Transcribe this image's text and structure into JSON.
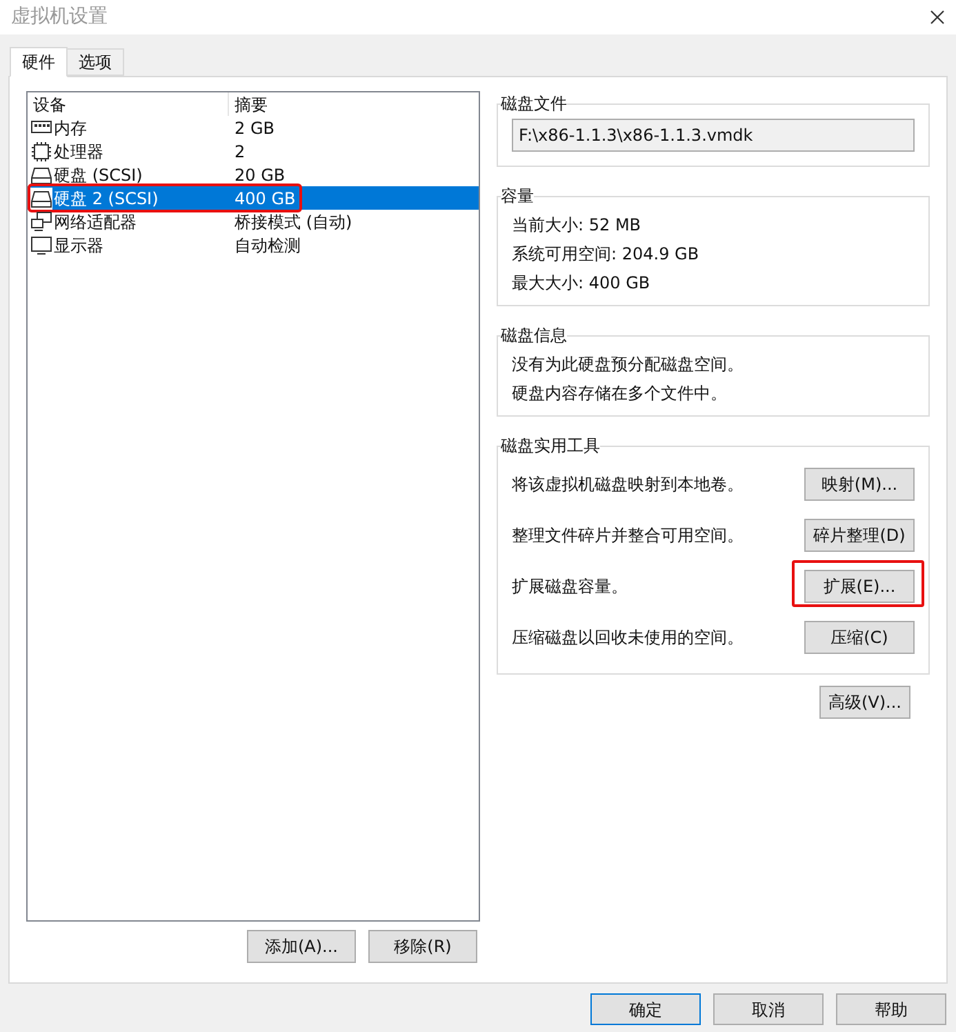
{
  "window": {
    "title": "虚拟机设置"
  },
  "tabs": [
    {
      "label": "硬件",
      "selected": true
    },
    {
      "label": "选项",
      "selected": false
    }
  ],
  "devices": {
    "columns": [
      "设备",
      "摘要"
    ],
    "rows": [
      {
        "kind": "memory",
        "name": "内存",
        "summary": "2 GB",
        "selected": false,
        "annotated": false
      },
      {
        "kind": "cpu",
        "name": "处理器",
        "summary": "2",
        "selected": false,
        "annotated": false
      },
      {
        "kind": "disk",
        "name": "硬盘 (SCSI)",
        "summary": "20 GB",
        "selected": false,
        "annotated": false
      },
      {
        "kind": "disk",
        "name": "硬盘 2 (SCSI)",
        "summary": "400 GB",
        "selected": true,
        "annotated": true
      },
      {
        "kind": "network",
        "name": "网络适配器",
        "summary": "桥接模式 (自动)",
        "selected": false,
        "annotated": false
      },
      {
        "kind": "display",
        "name": "显示器",
        "summary": "自动检测",
        "selected": false,
        "annotated": false
      }
    ],
    "buttons": [
      "添加(A)...",
      "移除(R)"
    ]
  },
  "disk_file": {
    "title": "磁盘文件",
    "value": "F:\\x86-1.1.3\\x86-1.1.3.vmdk"
  },
  "capacity": {
    "title": "容量",
    "lines": [
      "当前大小: 52 MB",
      "系统可用空间: 204.9 GB",
      "最大大小: 400 GB"
    ]
  },
  "disk_info": {
    "title": "磁盘信息",
    "lines": [
      "没有为此硬盘预分配磁盘空间。",
      "硬盘内容存储在多个文件中。"
    ]
  },
  "utilities": {
    "title": "磁盘实用工具",
    "items": [
      {
        "text": "将该虚拟机磁盘映射到本地卷。",
        "button": "映射(M)...",
        "annotated": false
      },
      {
        "text": "整理文件碎片并整合可用空间。",
        "button": "碎片整理(D)",
        "annotated": false
      },
      {
        "text": "扩展磁盘容量。",
        "button": "扩展(E)...",
        "annotated": true
      },
      {
        "text": "压缩磁盘以回收未使用的空间。",
        "button": "压缩(C)",
        "annotated": false
      }
    ]
  },
  "advanced_button": "高级(V)...",
  "footer_buttons": [
    {
      "label": "确定",
      "default": true
    },
    {
      "label": "取消",
      "default": false
    },
    {
      "label": "帮助",
      "default": false
    }
  ]
}
